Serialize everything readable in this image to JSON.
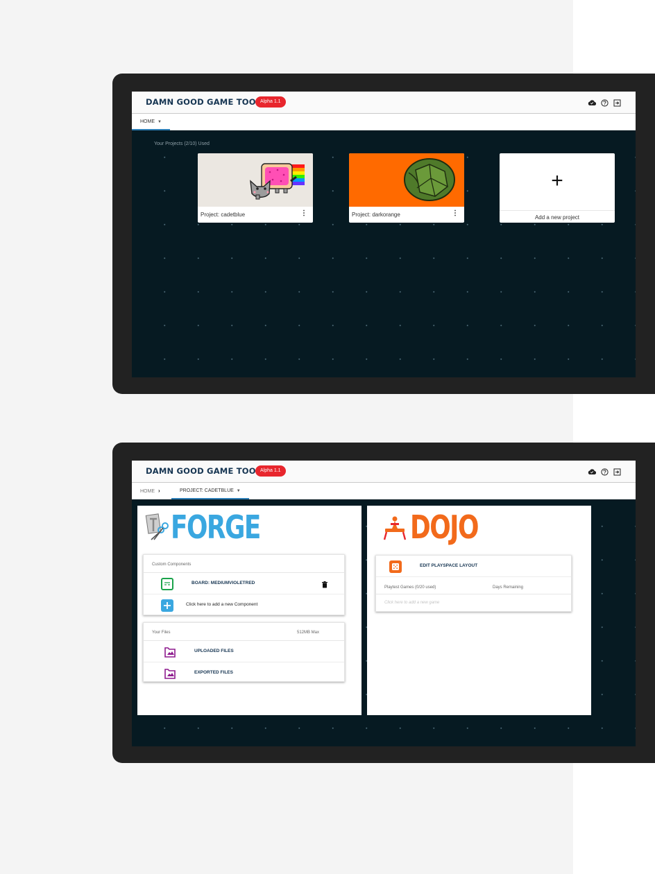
{
  "app": {
    "logo_text": "DAMN GOOD GAME TOOLS",
    "version_badge": "Alpha 1.1",
    "icons": [
      "cloud-check-icon",
      "help-circle-icon",
      "logout-icon"
    ],
    "colors": {
      "badge": "#e8262d",
      "logo": "#163552",
      "background": "#061a22",
      "accent": "#2e7fb8"
    }
  },
  "screen1": {
    "nav": {
      "home_label": "HOME"
    },
    "projects_caption": "Your Projects (2/10) Used",
    "projects": [
      {
        "label": "Project: cadetblue",
        "thumbnail": "nyan-cat-image"
      },
      {
        "label": "Project: darkorange",
        "thumbnail": "turtle-shell-image"
      }
    ],
    "add_project": {
      "plus": "+",
      "label": "Add a new project"
    }
  },
  "screen2": {
    "nav": {
      "home_label": "HOME",
      "project_label": "PROJECT: CADETBLUE"
    },
    "forge": {
      "title": "FORGE",
      "title_color": "#3aa7e0",
      "components_header": "Custom Components",
      "components": [
        {
          "label": "BOARD: MEDIUMVIOLETRED",
          "icon": "board-icon"
        }
      ],
      "add_component_label": "Click here to add a new Component",
      "files_header": "Your Files",
      "files_quota": "512MB Max",
      "files": [
        {
          "label": "UPLOADED FILES",
          "icon": "image-folder-icon"
        },
        {
          "label": "EXPORTED FILES",
          "icon": "image-folder-icon"
        }
      ]
    },
    "dojo": {
      "title": "DOJO",
      "title_color": "#f26a1b",
      "edit_layout_label": "EDIT PLAYSPACE LAYOUT",
      "playtest_header": "Playtest Games (0/20 used)",
      "days_remaining_header": "Days Remaining",
      "add_game_placeholder": "Click here to add a new game"
    }
  }
}
